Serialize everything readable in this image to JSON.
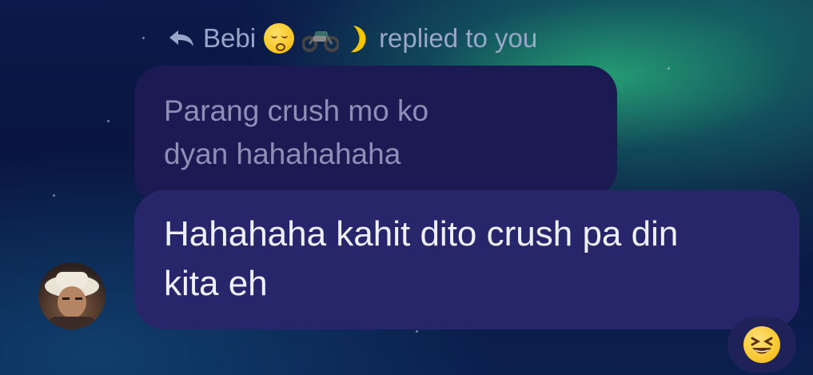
{
  "reply_header": {
    "icon": "reply-arrow-icon",
    "sender_name": "Bebi",
    "name_emojis": [
      "kissing-face-icon",
      "motorcycle-icon",
      "crescent-moon-icon"
    ],
    "suffix": "replied to you"
  },
  "quoted_message": {
    "line1": "Parang crush mo ko",
    "line2": "dyan hahahahaha"
  },
  "reply_message": {
    "line1": "Hahahaha kahit dito crush pa din",
    "line2": "kita eh"
  },
  "avatar": {
    "icon": "user-avatar"
  },
  "reaction": {
    "icon": "grinning-squinting-face-icon"
  },
  "colors": {
    "quoted_bubble": "#1b1a52",
    "reply_bubble": "#27266a",
    "header_text": "#9aa6c8",
    "message_text": "#eef0ff"
  }
}
